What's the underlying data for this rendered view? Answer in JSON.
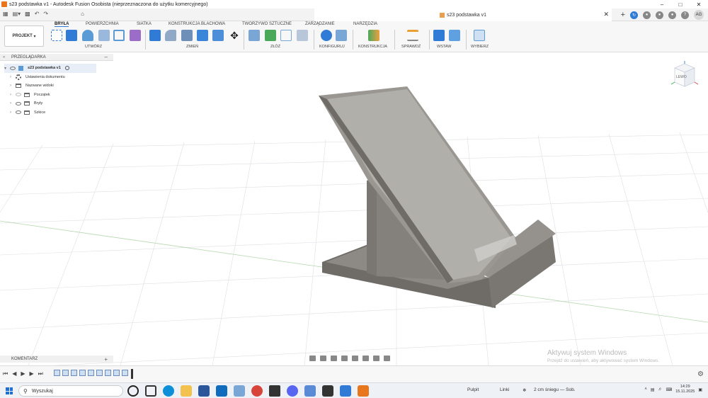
{
  "window": {
    "title": "s23 podstawka v1 - Autodesk Fusion Osobista (nieprzeznaczona do użytku komercyjnego)",
    "controls": [
      "minimize",
      "maximize",
      "close"
    ]
  },
  "document_tab": {
    "title": "s23 podstawka v1"
  },
  "header_icons": [
    "add-icon",
    "job-status-icon",
    "refresh-icon",
    "extensions-icon",
    "notifications-icon",
    "help-icon"
  ],
  "user": {
    "initials": "AG"
  },
  "toolbar": {
    "project_label": "PROJEKT",
    "tabs": [
      "BRYŁA",
      "POWIERZCHNIA",
      "SIATKA",
      "KONSTRUKCJA BLACHOWA",
      "TWORZYWO SZTUCZNE",
      "ZARZĄDZANIE",
      "NARZĘDZIA"
    ],
    "groups": [
      "UTWÓRZ",
      "ZMIEŃ",
      "ZŁÓŻ",
      "KONFIGURUJ",
      "KONSTRUKCJA",
      "SPRAWDŹ",
      "WSTAW",
      "WYBIERZ"
    ]
  },
  "browser": {
    "title": "PRZEGLĄDARKA",
    "root": "s23 podstawka v1",
    "items": [
      "Ustawienia dokumentu",
      "Nazwane widoki",
      "Początek",
      "Bryły",
      "Szkice"
    ]
  },
  "viewcube": {
    "face_label": "LEWO"
  },
  "comments": {
    "title": "KOMENTARZ"
  },
  "watermark": {
    "title": "Aktywuj system Windows",
    "subtitle": "Przejdź do ustawień, aby aktywować system Windows."
  },
  "taskbar": {
    "search_placeholder": "Wyszukaj",
    "toolbar1": "Pulpit",
    "toolbar2": "Linki",
    "weather": "2 cm śniegu — Sob.",
    "time": "14:29",
    "date": "15.11.2025"
  },
  "colors": {
    "accent": "#2f7bd6",
    "model": "#8a8782",
    "grid": "#d9dce0"
  }
}
